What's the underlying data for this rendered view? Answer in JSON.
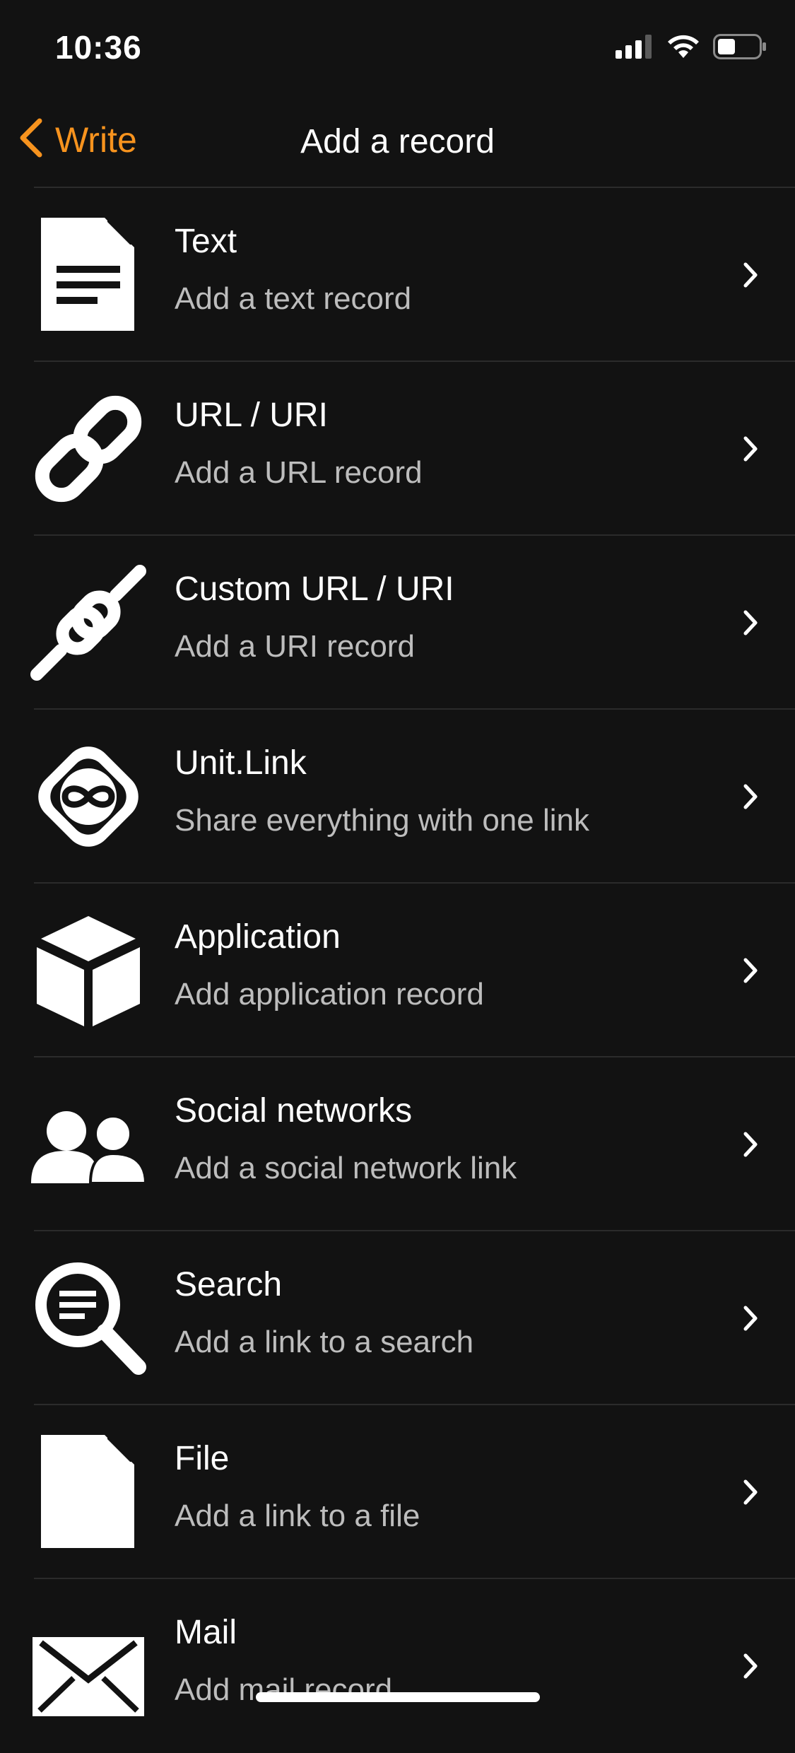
{
  "status_bar": {
    "time": "10:36"
  },
  "nav": {
    "back_label": "Write",
    "title": "Add a record"
  },
  "items": [
    {
      "title": "Text",
      "subtitle": "Add a text record",
      "icon": "text-document-icon"
    },
    {
      "title": "URL / URI",
      "subtitle": "Add a URL record",
      "icon": "link-icon"
    },
    {
      "title": "Custom URL / URI",
      "subtitle": "Add a URI record",
      "icon": "custom-link-icon"
    },
    {
      "title": "Unit.Link",
      "subtitle": "Share everything with one link",
      "icon": "unit-link-icon"
    },
    {
      "title": "Application",
      "subtitle": "Add application record",
      "icon": "cube-icon"
    },
    {
      "title": "Social networks",
      "subtitle": "Add a social network link",
      "icon": "people-icon"
    },
    {
      "title": "Search",
      "subtitle": "Add a link to a search",
      "icon": "search-icon"
    },
    {
      "title": "File",
      "subtitle": "Add a link to a file",
      "icon": "file-icon"
    },
    {
      "title": "Mail",
      "subtitle": "Add mail record",
      "icon": "mail-icon"
    }
  ],
  "colors": {
    "accent": "#f7931e",
    "background": "#121212",
    "subtitle": "#bdbdbd"
  }
}
